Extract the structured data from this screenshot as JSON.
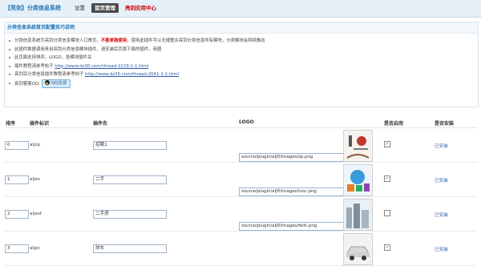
{
  "header": {
    "title": "【亮剑】分类信息系统",
    "tabs": [
      {
        "label": "设置"
      },
      {
        "label": "首页管理"
      },
      {
        "label": "亮剑应用中心"
      }
    ]
  },
  "notice": {
    "title": "分类信息系统首页配置技巧说明",
    "items": [
      {
        "pre": "分类信息系统为亮剑分类信息模块入口首页，",
        "warn": "不能单独使用",
        "post": "，使用此插件可以无缝整合亮剑分类信息所有模块，分类模块会持续推出"
      },
      {
        "text": "此插件数据调用来自亮剑分类信息模块插件，请安装后页面下面的插件，商圈"
      },
      {
        "text": "此页面支持排序，LOGO，各模块插件关"
      },
      {
        "pre": "插件教程请参考帖子 ",
        "link": "http://www.dz30.com/thread-2229-1-1.html"
      },
      {
        "pre": "亮剑百分类信息插件教程请参考帖子 ",
        "link": "http://www.dz30.com/thread-2041-1-1.html"
      },
      {
        "pre": "亮剑客服QQ:",
        "button": "QQ交谈"
      }
    ]
  },
  "table": {
    "headers": {
      "order": "排序",
      "ident": "插件标识",
      "name": "插件名",
      "logo": "LOGO",
      "enabled": "是否启用",
      "installed": "是否安装"
    },
    "rows": [
      {
        "order": "0",
        "ident": "aljzp",
        "name": "招聘1",
        "logo": "source/plugin/aljfl/images/zp.png",
        "enabled": true,
        "installed": "已安装",
        "thumb": "recruit"
      },
      {
        "order": "1",
        "ident": "aljes",
        "name": "二手",
        "logo": "source/plugin/aljfl/images/tzsc.png",
        "enabled": true,
        "installed": "已安装",
        "thumb": "secondhand"
      },
      {
        "order": "2",
        "ident": "aljesf",
        "name": "二手房",
        "logo": "source/plugin/aljfl/images/fwfc.png",
        "enabled": false,
        "installed": "已安装",
        "thumb": "house"
      },
      {
        "order": "3",
        "ident": "aljpc",
        "name": "拼车",
        "logo": "",
        "enabled": true,
        "installed": "已安装",
        "thumb": "car"
      }
    ]
  }
}
